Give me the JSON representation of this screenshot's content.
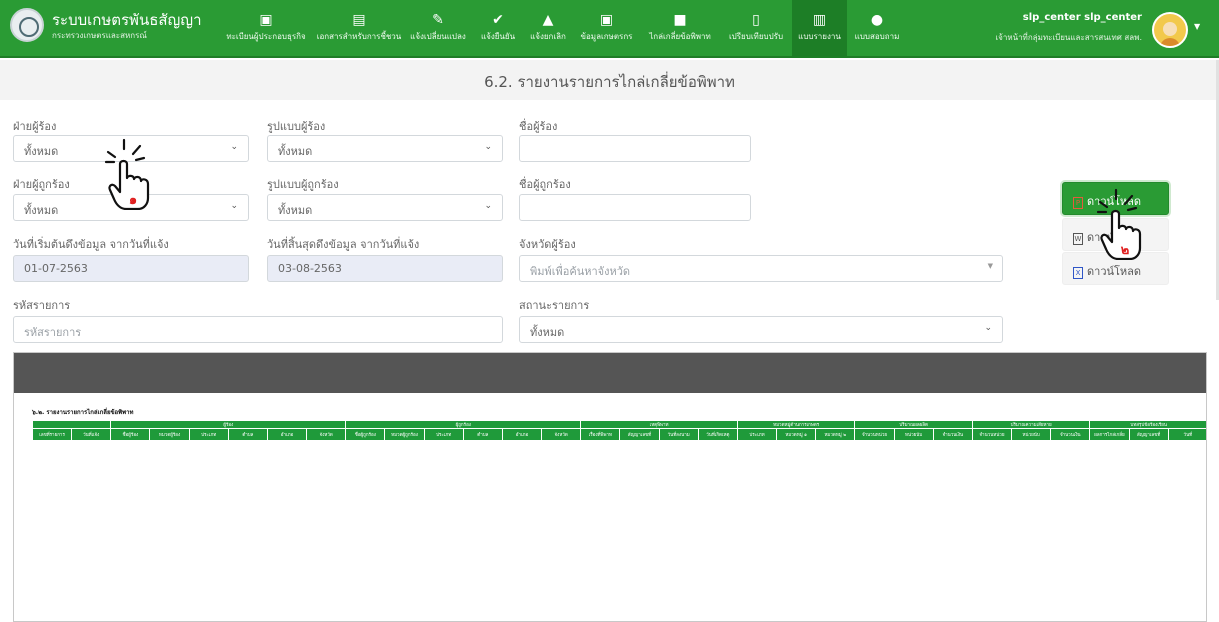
{
  "header": {
    "title": "ระบบเกษตรพันธสัญญา",
    "subtitle": "กระทรวงเกษตรและสหกรณ์",
    "nav": [
      {
        "label": "ทะเบียนผู้ประกอบธุรกิจ",
        "icon": "id-card-icon"
      },
      {
        "label": "เอกสารสำหรับการชี้ชวน",
        "icon": "clipboard-icon"
      },
      {
        "label": "แจ้งเปลี่ยนแปลง",
        "icon": "edit-icon"
      },
      {
        "label": "แจ้งยืนยัน",
        "icon": "check-circle-icon"
      },
      {
        "label": "แจ้งยกเลิก",
        "icon": "warning-icon"
      },
      {
        "label": "ข้อมูลเกษตรกร",
        "icon": "id-card-icon"
      },
      {
        "label": "ไกล่เกลี่ยข้อพิพาท",
        "icon": "chat-icon"
      },
      {
        "label": "เปรียบเทียบปรับ",
        "icon": "document-icon"
      },
      {
        "label": "แบบรายงาน",
        "icon": "bar-chart-icon",
        "active": true
      },
      {
        "label": "แบบสอบถาม",
        "icon": "comments-icon"
      }
    ],
    "user": {
      "name": "slp_center slp_center",
      "role": "เจ้าหน้าที่กลุ่มทะเบียนและสารสนเทศ สลพ.",
      "caret": "▼"
    }
  },
  "page_title": "6.2. รายงานรายการไกล่เกลี่ยข้อพิพาท",
  "filters": {
    "complainant_side": {
      "label": "ฝ่ายผู้ร้อง",
      "value": "ทั้งหมด"
    },
    "complainant_type": {
      "label": "รูปแบบผู้ร้อง",
      "value": "ทั้งหมด"
    },
    "complainant_name": {
      "label": "ชื่อผู้ร้อง",
      "value": ""
    },
    "respondent_side": {
      "label": "ฝ่ายผู้ถูกร้อง",
      "value": "ทั้งหมด"
    },
    "respondent_type": {
      "label": "รูปแบบผู้ถูกร้อง",
      "value": "ทั้งหมด"
    },
    "respondent_name": {
      "label": "ชื่อผู้ถูกร้อง",
      "value": ""
    },
    "start_date": {
      "label": "วันที่เริ่มต้นดึงข้อมูล จากวันที่แจ้ง",
      "value": "01-07-2563"
    },
    "end_date": {
      "label": "วันที่สิ้นสุดดึงข้อมูล จากวันที่แจ้ง",
      "value": "03-08-2563"
    },
    "province": {
      "label": "จังหวัดผู้ร้อง",
      "placeholder": "พิมพ์เพื่อค้นหาจังหวัด"
    },
    "item_code": {
      "label": "รหัสรายการ",
      "placeholder": "รหัสรายการ"
    },
    "item_status": {
      "label": "สถานะรายการ",
      "value": "ทั้งหมด"
    }
  },
  "downloads": {
    "pdf": "ดาวน์โหลด",
    "word": "ดาวน์โหลด",
    "excel": "ดาวน์โหลด"
  },
  "report": {
    "title": "๖.๒. รายงานรายการไกล่เกลี่ยข้อพิพาท",
    "groups": [
      "",
      "ผู้ร้อง",
      "ผู้ถูกร้อง",
      "เหตุพิพาท",
      "หมวดหมู่ด้านการเกษตร",
      "ปริมาณผลผลิต",
      "ปริมาณความเสียหาย",
      "บทสรุปข้อร้องเรียน"
    ],
    "columns": [
      "เลขที่รายการ",
      "วันที่แจ้ง",
      "ชื่อผู้ร้อง",
      "หมวดผู้ร้อง",
      "ประเภท",
      "ตำบล",
      "อำเภอ",
      "จังหวัด",
      "ชื่อผู้ถูกร้อง",
      "หมวดผู้ถูกร้อง",
      "ประเภท",
      "ตำบล",
      "อำเภอ",
      "จังหวัด",
      "เรื่องที่พิพาท",
      "สัญญาเลขที่",
      "วันที่ลงนาม",
      "วันที่เกิดเหตุ",
      "ประเภท",
      "หมวดหมู่ ๑",
      "หมวดหมู่ ๒",
      "จำนวนหน่วย",
      "หน่วยนับ",
      "จำนวนเงิน",
      "จำนวนหน่วย",
      "หน่วยนับ",
      "จำนวนเงิน",
      "ผลการไกล่เกลี่ย",
      "สัญญาเลขที่",
      "วันที่"
    ]
  },
  "markers": {
    "one": "๑",
    "two": "๒"
  },
  "colors": {
    "header_green": "#2a9b34",
    "table_green": "#1f9a3a",
    "preview_bar": "#555555"
  }
}
